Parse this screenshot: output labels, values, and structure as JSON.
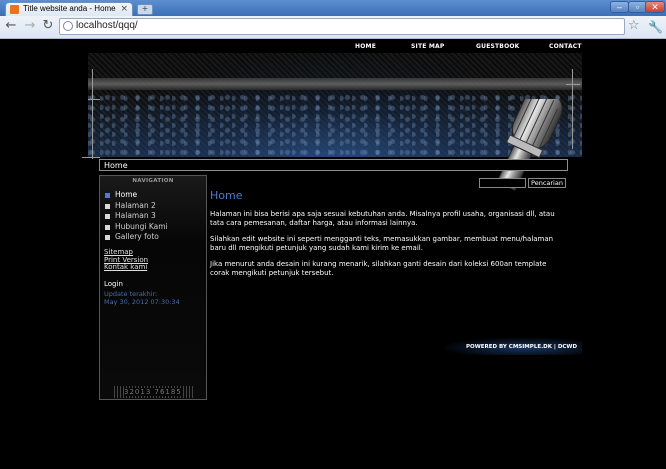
{
  "browser": {
    "tab_title": "Title website anda - Home",
    "tab_close": "×",
    "new_tab": "+",
    "url": "localhost/qqq/",
    "min": "–",
    "max": "▫",
    "close": "✕",
    "back": "←",
    "forward": "→",
    "reload": "↻",
    "star": "☆",
    "wrench": "🔧"
  },
  "topnav": [
    "HOME",
    "SITE MAP",
    "GUESTBOOK",
    "CONTACT"
  ],
  "breadcrumb": "Home",
  "sidebar": {
    "title": "NAVIGATION",
    "menu": [
      "Home",
      "Halaman 2",
      "Halaman 3",
      "Hubungi Kami",
      "Gallery foto"
    ],
    "links": [
      "Sitemap",
      "Print Version",
      "Kontak kami"
    ],
    "login": "Login",
    "updated_label": "Update terakhir:",
    "updated_value": "May 30, 2012 07:30:34",
    "barcode": "32013 76185"
  },
  "search": {
    "button": "Pencarian",
    "value": ""
  },
  "main": {
    "title": "Home",
    "paragraphs": [
      "Halaman ini bisa berisi apa saja sesuai kebutuhan anda. Misalnya profil usaha, organisasi dll, atau tata cara pemesanan, daftar harga, atau informasi lainnya.",
      "Silahkan edit website ini seperti mengganti teks, memasukkan gambar, membuat menu/halaman baru dll mengikuti petunjuk yang sudah kami kirim ke email.",
      "Jika menurut anda desain ini kurang menarik, silahkan ganti desain dari koleksi 600an template corak mengikuti petunjuk tersebut."
    ]
  },
  "footer": "POWERED BY CMSIMPLE.DK | DCWD"
}
